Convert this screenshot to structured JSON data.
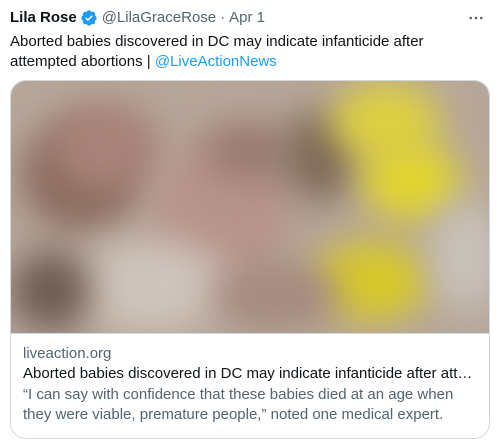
{
  "author": {
    "name": "Lila Rose",
    "handle": "@LilaGraceRose",
    "separator": "·",
    "date": "Apr 1",
    "verified_color": "#1d9bf0"
  },
  "tweet": {
    "text": "Aborted babies discovered in DC may indicate infanticide after attempted abortions | ",
    "mention": "@LiveActionNews"
  },
  "card": {
    "domain": "liveaction.org",
    "title": "Aborted babies discovered in DC may indicate infanticide after attem…",
    "description": "“I can say with confidence that these babies died at an age when they were viable, premature people,” noted one medical expert."
  },
  "icons": {
    "verified": "verified-badge-icon",
    "more": "more-dots-icon"
  },
  "colors": {
    "accent": "#1d9bf0",
    "text": "#0f1419",
    "muted": "#536471",
    "border": "#cfd9de"
  }
}
